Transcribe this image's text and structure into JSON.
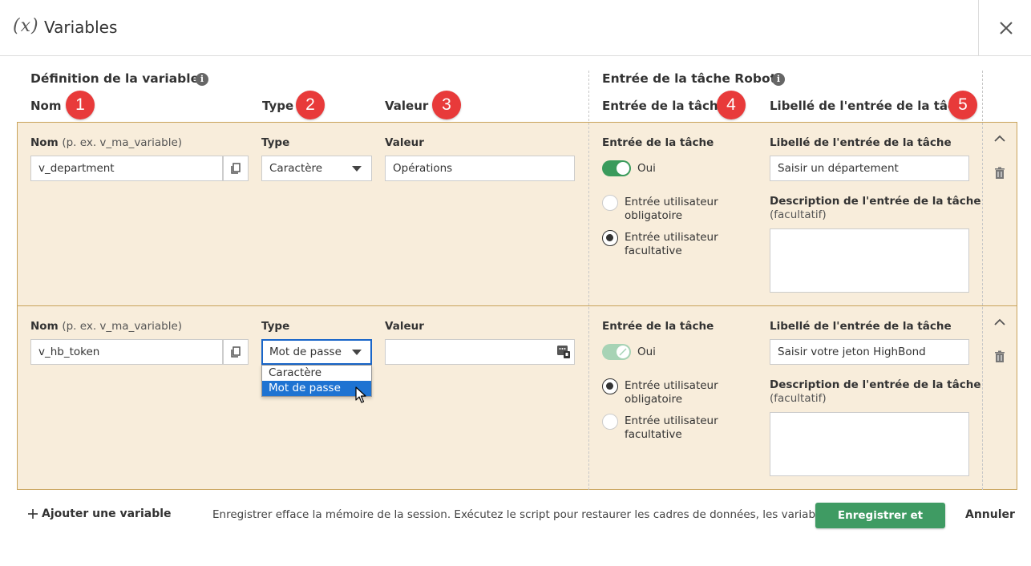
{
  "header": {
    "icon_text": "(x)",
    "title": "Variables"
  },
  "sections": {
    "definition_title": "Définition de la variable",
    "robot_title": "Entrée de la tâche Robot"
  },
  "columns": [
    {
      "label": "Nom",
      "badge": "1"
    },
    {
      "label": "Type",
      "badge": "2"
    },
    {
      "label": "Valeur",
      "badge": "3"
    },
    {
      "label": "Entrée de la tâche",
      "badge": "4"
    },
    {
      "label": "Libellé de l'entrée de la tâche",
      "badge": "5"
    }
  ],
  "row_labels": {
    "name": "Nom",
    "name_hint": "(p. ex. v_ma_variable)",
    "type": "Type",
    "value": "Valeur",
    "task_input": "Entrée de la tâche",
    "task_input_label": "Libellé de l'entrée de la tâche",
    "description": "Description de l'entrée de la tâche",
    "description_hint": "(facultatif)",
    "required": "Entrée utilisateur obligatoire",
    "optional": "Entrée utilisateur facultative"
  },
  "rows": [
    {
      "name": "v_department",
      "type": "Caractère",
      "value": "Opérations",
      "toggle_label": "Oui",
      "toggle_on": true,
      "selected_input": "optional",
      "input_label": "Saisir un département",
      "description": ""
    },
    {
      "name": "v_hb_token",
      "type": "Mot de passe",
      "value": "",
      "toggle_label": "Oui",
      "toggle_on": true,
      "selected_input": "required",
      "input_label": "Saisir votre jeton HighBond",
      "description": ""
    }
  ],
  "dropdown": {
    "options": [
      "Caractère",
      "Mot de passe"
    ],
    "selected": "Mot de passe"
  },
  "footer": {
    "add_label": "Ajouter une variable",
    "message": "Enregistrer efface la mémoire de la session. Exécutez le script pour restaurer les cadres de données, les variables, etc.",
    "save_label": "Enregistrer et fermer",
    "cancel_label": "Annuler"
  },
  "colors": {
    "row_background": "#f8eddb",
    "row_border": "#c9a35a",
    "badge": "#e83a3a",
    "toggle_on": "#3a9b5c",
    "save_button": "#3f9b63",
    "dropdown_selected": "#1e73d2"
  }
}
